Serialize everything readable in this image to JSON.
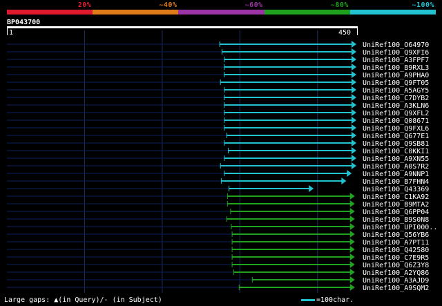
{
  "legend": {
    "segments": [
      {
        "label": "20%",
        "color": "#e01a2e"
      },
      {
        "label": "~40%",
        "color": "#e07b1a"
      },
      {
        "label": "~60%",
        "color": "#9b35a5"
      },
      {
        "label": "~80%",
        "color": "#1fa31f"
      },
      {
        "label": "~100%",
        "color": "#22c3d1"
      }
    ]
  },
  "query": {
    "id": "BP043700",
    "start_label": "1",
    "end_label": "450",
    "length": 450
  },
  "colors": {
    "track": "#0b1f5e",
    "gridline": "#1c3160",
    "cyan": "#22c3d1",
    "green": "#1fa31f",
    "text": "#ffffff"
  },
  "hits": [
    {
      "name": "UniRef100_O64970",
      "start": 274,
      "end": 450,
      "identity": "~100%"
    },
    {
      "name": "UniRef100_Q9XFI6",
      "start": 277,
      "end": 450,
      "identity": "~100%"
    },
    {
      "name": "UniRef100_A3FPF7",
      "start": 280,
      "end": 450,
      "identity": "~100%"
    },
    {
      "name": "UniRef100_B9RXL3",
      "start": 280,
      "end": 450,
      "identity": "~100%"
    },
    {
      "name": "UniRef100_A9PHA0",
      "start": 280,
      "end": 450,
      "identity": "~100%"
    },
    {
      "name": "UniRef100_Q9FT05",
      "start": 275,
      "end": 450,
      "identity": "~100%"
    },
    {
      "name": "UniRef100_A5AGY5",
      "start": 280,
      "end": 450,
      "identity": "~100%"
    },
    {
      "name": "UniRef100_C7DYB2",
      "start": 280,
      "end": 450,
      "identity": "~100%"
    },
    {
      "name": "UniRef100_A3KLN6",
      "start": 280,
      "end": 450,
      "identity": "~100%"
    },
    {
      "name": "UniRef100_Q9XFL2",
      "start": 280,
      "end": 450,
      "identity": "~100%"
    },
    {
      "name": "UniRef100_Q08671",
      "start": 280,
      "end": 450,
      "identity": "~100%"
    },
    {
      "name": "UniRef100_Q9FXL6",
      "start": 280,
      "end": 450,
      "identity": "~100%"
    },
    {
      "name": "UniRef100_Q677E1",
      "start": 283,
      "end": 450,
      "identity": "~100%"
    },
    {
      "name": "UniRef100_Q9SB81",
      "start": 280,
      "end": 450,
      "identity": "~100%"
    },
    {
      "name": "UniRef100_C0KKI1",
      "start": 285,
      "end": 450,
      "identity": "~100%"
    },
    {
      "name": "UniRef100_A9XN55",
      "start": 280,
      "end": 450,
      "identity": "~100%"
    },
    {
      "name": "UniRef100_A0S7R2",
      "start": 275,
      "end": 450,
      "identity": "~100%"
    },
    {
      "name": "UniRef100_A9NNP1",
      "start": 280,
      "end": 444,
      "identity": "~100%"
    },
    {
      "name": "UniRef100_B7FHN4",
      "start": 276,
      "end": 437,
      "identity": "~100%"
    },
    {
      "name": "UniRef100_Q43369",
      "start": 286,
      "end": 395,
      "identity": "~100%"
    },
    {
      "name": "UniRef100_C1KA92",
      "start": 284,
      "end": 448,
      "identity": "~80%"
    },
    {
      "name": "UniRef100_B9MTA2",
      "start": 284,
      "end": 448,
      "identity": "~80%"
    },
    {
      "name": "UniRef100_Q6PP04",
      "start": 288,
      "end": 448,
      "identity": "~80%"
    },
    {
      "name": "UniRef100_B9S0N8",
      "start": 283,
      "end": 448,
      "identity": "~80%"
    },
    {
      "name": "UniRef100_UPI000..",
      "start": 289,
      "end": 448,
      "identity": "~80%"
    },
    {
      "name": "UniRef100_Q56YB6",
      "start": 290,
      "end": 448,
      "identity": "~80%"
    },
    {
      "name": "UniRef100_A7PT11",
      "start": 290,
      "end": 448,
      "identity": "~80%"
    },
    {
      "name": "UniRef100_Q42580",
      "start": 290,
      "end": 448,
      "identity": "~80%"
    },
    {
      "name": "UniRef100_C7E9R5",
      "start": 290,
      "end": 448,
      "identity": "~80%"
    },
    {
      "name": "UniRef100_Q6Z3Y8",
      "start": 290,
      "end": 448,
      "identity": "~80%"
    },
    {
      "name": "UniRef100_A2YQ86",
      "start": 292,
      "end": 448,
      "identity": "~80%"
    },
    {
      "name": "UniRef100_A3AJD9",
      "start": 316,
      "end": 448,
      "identity": "~80%"
    },
    {
      "name": "UniRef100_A9SQM2",
      "start": 299,
      "end": 448,
      "identity": "~80%"
    }
  ],
  "footer": {
    "gaps_label": "Large gaps:",
    "query_gap_symbol": "▲",
    "query_gap_text": "(in Query)/- (in Subject)",
    "scale_text": "=100char."
  }
}
